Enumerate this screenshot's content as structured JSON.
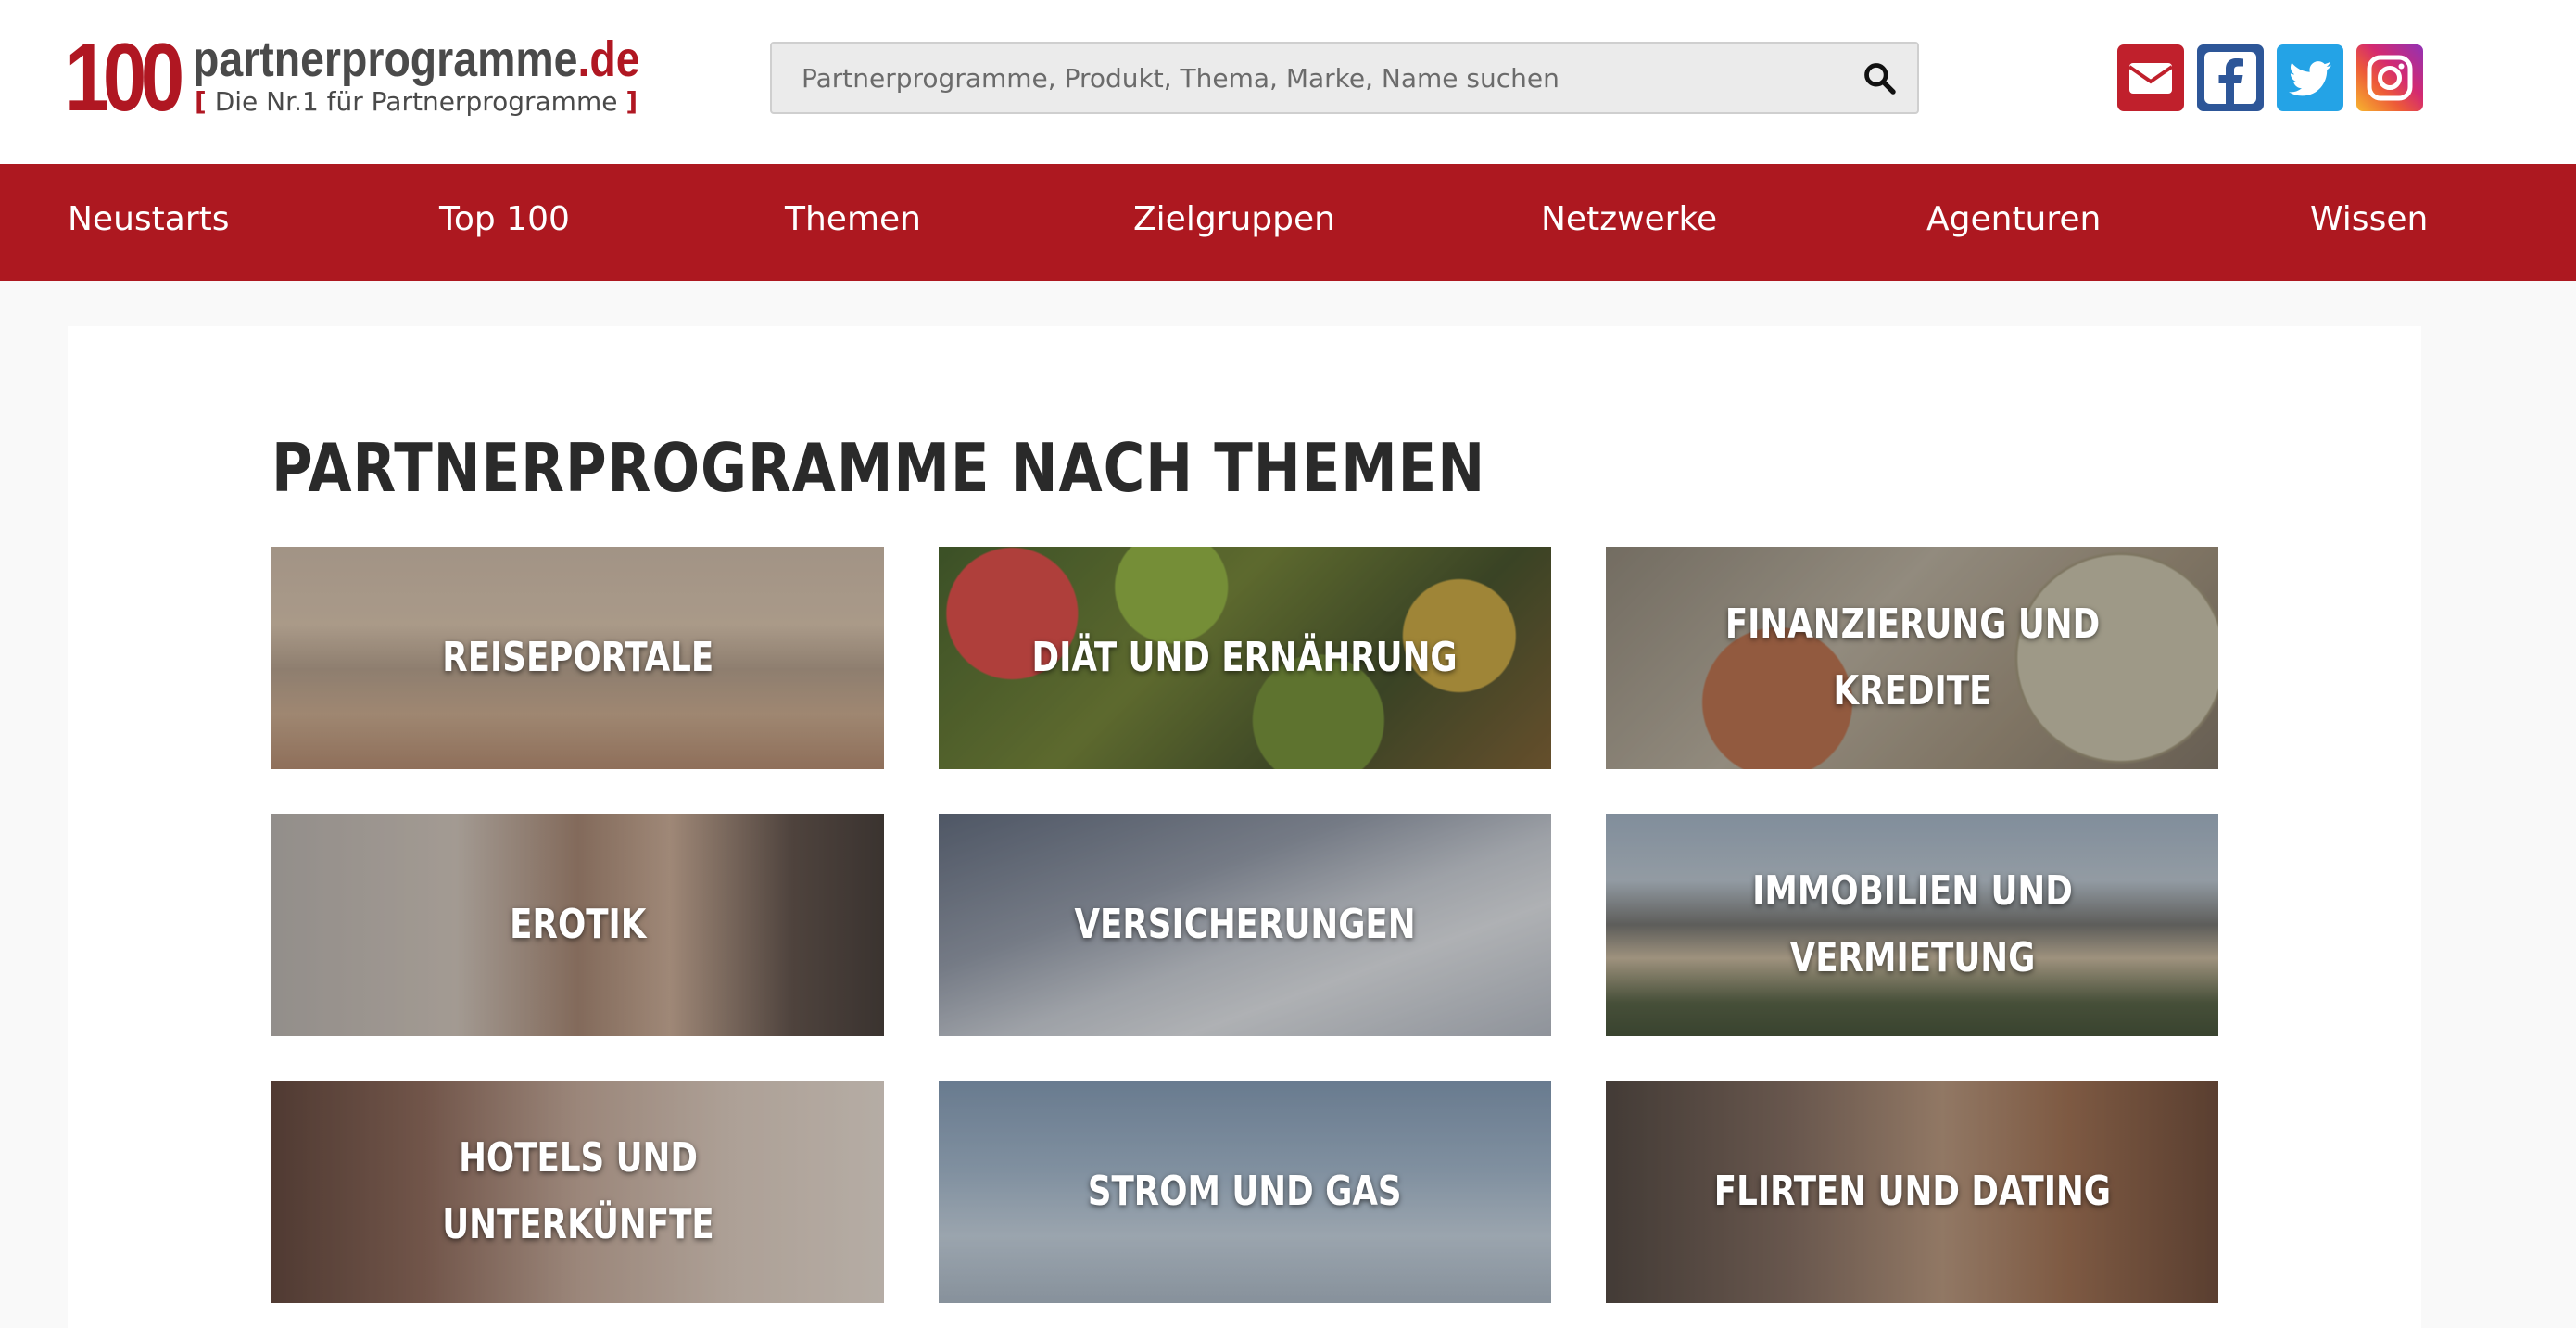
{
  "header": {
    "logo": {
      "number": "100",
      "name": "partnerprogramme",
      "tld": ".de",
      "tagline_open": "[",
      "tagline": " Die Nr.1 für Partnerprogramme ",
      "tagline_close": "]"
    },
    "search": {
      "placeholder": "Partnerprogramme, Produkt, Thema, Marke, Name suchen",
      "value": ""
    },
    "social": [
      {
        "name": "mail",
        "icon": "envelope-icon",
        "color": "#c0202c"
      },
      {
        "name": "facebook",
        "icon": "facebook-icon",
        "color": "#2d5698"
      },
      {
        "name": "twitter",
        "icon": "twitter-icon",
        "color": "#24a3e6"
      },
      {
        "name": "instagram",
        "icon": "instagram-icon",
        "color": "#d42a70"
      }
    ]
  },
  "nav": {
    "color": "#ad1820",
    "items": [
      "Neustarts",
      "Top 100",
      "Themen",
      "Zielgruppen",
      "Netzwerke",
      "Agenturen",
      "Wissen"
    ]
  },
  "main": {
    "title": "PARTNERPROGRAMME NACH THEMEN",
    "tiles": [
      {
        "label": "REISEPORTALE"
      },
      {
        "label": "DIÄT UND ERNÄHRUNG"
      },
      {
        "label": "FINANZIERUNG UND KREDITE"
      },
      {
        "label": "EROTIK"
      },
      {
        "label": "VERSICHERUNGEN"
      },
      {
        "label": "IMMOBILIEN UND VERMIETUNG"
      },
      {
        "label": "HOTELS UND UNTERKÜNFTE"
      },
      {
        "label": "STROM UND GAS"
      },
      {
        "label": "FLIRTEN UND DATING"
      }
    ]
  }
}
